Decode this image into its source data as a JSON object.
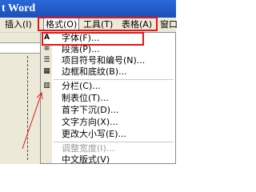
{
  "window": {
    "title": "t Word"
  },
  "menubar": {
    "items": [
      {
        "label": "插入(I)"
      },
      {
        "label": "格式(O)"
      },
      {
        "label": "工具(T)"
      },
      {
        "label": "表格(A)"
      },
      {
        "label": "窗口"
      }
    ]
  },
  "format_menu": {
    "items": [
      {
        "label": "字体(F)...",
        "icon": "font-icon",
        "glyph": "A"
      },
      {
        "label": "段落(P)...",
        "icon": "paragraph-icon",
        "glyph": "≡"
      },
      {
        "label": "项目符号和编号(N)...",
        "icon": "bullets-icon",
        "glyph": "☰"
      },
      {
        "label": "边框和底纹(B)...",
        "icon": "border-icon",
        "glyph": "▦"
      },
      {
        "label": "分栏(C)...",
        "icon": "columns-icon",
        "glyph": "▥"
      },
      {
        "label": "制表位(T)...",
        "icon": "tab-stop-icon",
        "glyph": ""
      },
      {
        "label": "首字下沉(D)...",
        "icon": "drop-cap-icon",
        "glyph": ""
      },
      {
        "label": "文字方向(X)...",
        "icon": "text-direction-icon",
        "glyph": ""
      },
      {
        "label": "更改大小写(E)...",
        "icon": "change-case-icon",
        "glyph": ""
      },
      {
        "label": "调整宽度(I)...",
        "icon": "fit-width-icon",
        "glyph": ""
      },
      {
        "label": "中文版式(V)",
        "icon": "asian-layout-icon",
        "glyph": ""
      }
    ]
  },
  "colors": {
    "highlight": "#e01818",
    "title_bar": "#1f5cc9",
    "menu_bg": "#ece9d8"
  }
}
